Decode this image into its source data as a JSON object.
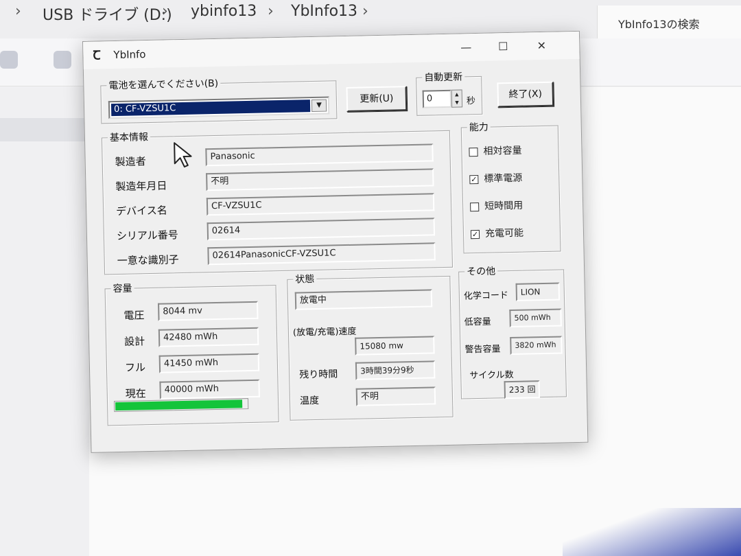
{
  "explorer": {
    "breadcrumb": [
      "USB ドライブ (D:)",
      "ybinfo13",
      "YbInfo13"
    ],
    "search_placeholder": "YbInfo13の検索"
  },
  "window": {
    "title": "YbInfo",
    "controls": {
      "minimize": "—",
      "maximize": "☐",
      "close": "✕"
    }
  },
  "battery_select": {
    "label": "電池を選んでください(B)",
    "selected": "0: CF-VZSU1C"
  },
  "buttons": {
    "refresh": "更新(U)",
    "exit": "終了(X)"
  },
  "auto_update": {
    "label": "自動更新",
    "value": "0",
    "unit": "秒"
  },
  "basic_info": {
    "title": "基本情報",
    "rows": [
      {
        "label": "製造者",
        "value": "Panasonic"
      },
      {
        "label": "製造年月日",
        "value": "不明"
      },
      {
        "label": "デバイス名",
        "value": "CF-VZSU1C"
      },
      {
        "label": "シリアル番号",
        "value": "02614"
      },
      {
        "label": "一意な識別子",
        "value": "02614PanasonicCF-VZSU1C"
      }
    ]
  },
  "capability": {
    "title": "能力",
    "items": [
      {
        "label": "相対容量",
        "checked": false
      },
      {
        "label": "標準電源",
        "checked": true
      },
      {
        "label": "短時間用",
        "checked": false
      },
      {
        "label": "充電可能",
        "checked": true
      }
    ]
  },
  "capacity": {
    "title": "容量",
    "rows": [
      {
        "label": "電圧",
        "value": "8044 mv"
      },
      {
        "label": "設計",
        "value": "42480 mWh"
      },
      {
        "label": "フル",
        "value": "41450 mWh"
      },
      {
        "label": "現在",
        "value": "40000 mWh"
      }
    ],
    "level": 0.965
  },
  "status": {
    "title": "状態",
    "state": "放電中",
    "rate_label": "(放電/充電)速度",
    "rate_value": "15080 mw",
    "remaining_label": "残り時間",
    "remaining_value": "3時間39分9秒",
    "temp_label": "温度",
    "temp_value": "不明"
  },
  "other": {
    "title": "その他",
    "chem_label": "化学コード",
    "chem_value": "LION",
    "low_label": "低容量",
    "low_value": "500 mWh",
    "warn_label": "警告容量",
    "warn_value": "3820 mWh",
    "cycle_label": "サイクル数",
    "cycle_value": "233 回"
  },
  "colors": {
    "selection": "#0a246a",
    "progress": "#14c43a"
  }
}
